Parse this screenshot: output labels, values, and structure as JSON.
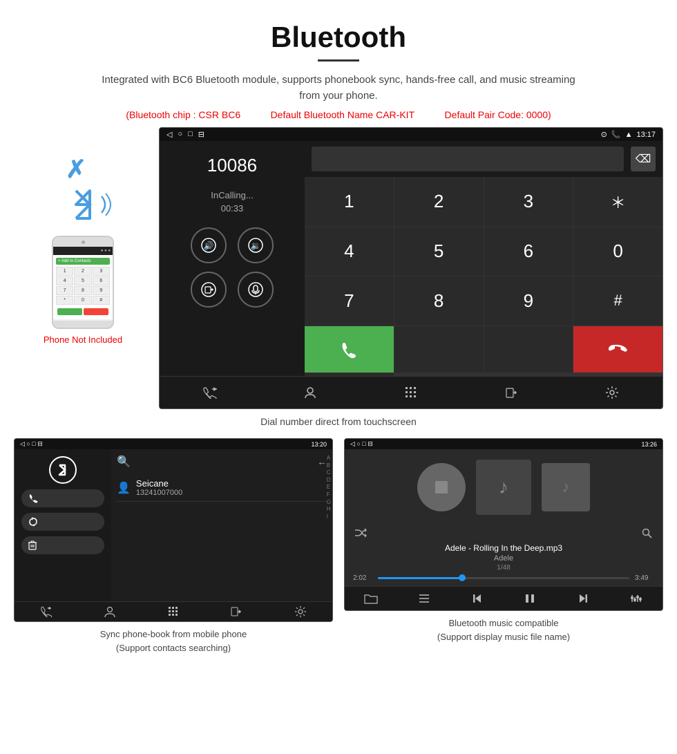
{
  "header": {
    "title": "Bluetooth",
    "subtitle": "Integrated with BC6 Bluetooth module, supports phonebook sync, hands-free call, and music streaming from your phone.",
    "specs": {
      "chip": "(Bluetooth chip : CSR BC6",
      "name": "Default Bluetooth Name CAR-KIT",
      "code": "Default Pair Code: 0000)"
    }
  },
  "dialer": {
    "number": "10086",
    "status": "InCalling...",
    "timer": "00:33",
    "time": "13:17",
    "keys": [
      "1",
      "2",
      "3",
      "*",
      "4",
      "5",
      "6",
      "0",
      "7",
      "8",
      "9",
      "#"
    ],
    "backspace_symbol": "⌫",
    "call_icon": "📞",
    "end_icon": "📵"
  },
  "phonebook": {
    "time": "13:20",
    "contact_name": "Seicane",
    "contact_number": "13241007000",
    "alphabet": [
      "A",
      "B",
      "C",
      "D",
      "E",
      "F",
      "G",
      "H",
      "I"
    ]
  },
  "music": {
    "time": "13:26",
    "title": "Adele - Rolling In the Deep.mp3",
    "artist": "Adele",
    "track": "1/48",
    "current_time": "2:02",
    "total_time": "3:49"
  },
  "captions": {
    "dialer": "Dial number direct from touchscreen",
    "phonebook": "Sync phone-book from mobile phone\n(Support contacts searching)",
    "phonebook_line1": "Sync phone-book from mobile phone",
    "phonebook_line2": "(Support contacts searching)",
    "music_line1": "Bluetooth music compatible",
    "music_line2": "(Support display music file name)"
  },
  "phone_not_included": "Phone Not Included"
}
